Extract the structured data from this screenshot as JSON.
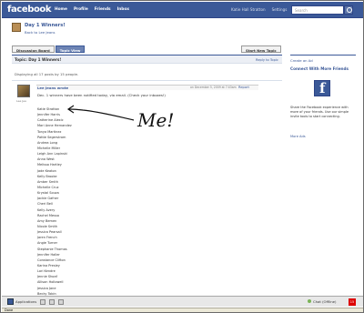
{
  "topbar": {
    "logo": "facebook",
    "nav": [
      "Home",
      "Profile",
      "Friends",
      "Inbox"
    ],
    "user_nav": [
      "Katie Hall Stratton",
      "Settings",
      "Logout"
    ],
    "search_placeholder": "Search"
  },
  "group": {
    "title": "Day 1 Winners!",
    "back_link": "Back to Lee Jeans"
  },
  "tabs": [
    "Discussion Board",
    "Topic View"
  ],
  "new_topic_label": "Start New Topic",
  "topic": {
    "header": "Topic: Day 1 Winners!",
    "reply_link": "Reply to Topic",
    "displaying": "Displaying all 17 posts by 15 people.",
    "post": {
      "author": "Lee Jeans wrote",
      "date": "on December 5, 2009 at 7:43am",
      "report": "Report",
      "avatar_caption": "Lee Jea",
      "message": "Dec. 1 winners have been notified today, via email. (Check your inboxes!)",
      "names": [
        "Katie Stratton",
        "Jennifer Harris",
        "Catherine Alexic",
        "Mari Anne Hernandez",
        "Tonya Martinez",
        "Pattie Segerstrom",
        "Andrea Long",
        "Michelle Miller",
        "Leigh Ann Lapinski",
        "Anna West",
        "Melissa Hartley",
        "Jade Keaton",
        "Kelly Brooke",
        "Amber Smith",
        "Michelle Cruz",
        "Krystal Souza",
        "Jackie Gafner",
        "Cheri Bell",
        "Kelly Avery",
        "Rachel Messa",
        "Amy Bemen",
        "Nicole Smith",
        "Jessica Pearsall",
        "Jaren French",
        "Angie Turner",
        "Stephanie Thomas",
        "Jennifer Haller",
        "Constance Clifton",
        "Karina Presley",
        "Lori Kendre",
        "Jennie Shoaf",
        "Allison Hollowell",
        "Jessica Jane",
        "Becky Tobin",
        "Karen Spector",
        "Marcia Rhodes"
      ]
    }
  },
  "sidebar": {
    "create_ad": "Create an Ad",
    "connect_title": "Connect With More Friends",
    "connect_text": "Share the Facebook experience with more of your friends. Use our simple invite tools to start connecting.",
    "more_ads": "More Ads"
  },
  "annotation": "Me!",
  "chatbar": {
    "applications": "Applications",
    "chat": "Chat (Offline)",
    "notifications": "15"
  },
  "statusbar": "Done",
  "colors": {
    "fb_blue": "#3b5998",
    "tab_active": "#6d84b4"
  }
}
